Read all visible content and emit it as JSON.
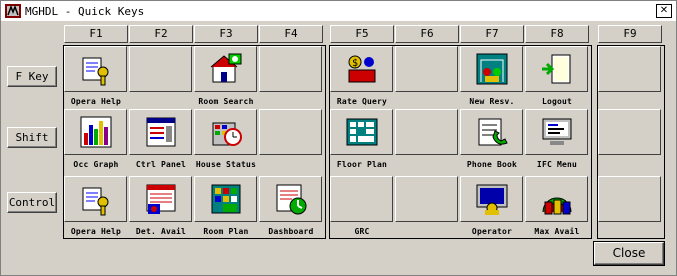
{
  "window": {
    "title": "MGHDL - Quick Keys",
    "close_glyph": "✕"
  },
  "side_buttons": {
    "fkey": "F Key",
    "shift": "Shift",
    "control": "Control"
  },
  "fkeys": [
    "F1",
    "F2",
    "F3",
    "F4",
    "F5",
    "F6",
    "F7",
    "F8",
    "F9"
  ],
  "rows": {
    "fkey": [
      "Opera Help",
      "",
      "Room Search",
      "",
      "Rate Query",
      "",
      "New Resv.",
      "Logout",
      ""
    ],
    "shift": [
      "Occ Graph",
      "Ctrl Panel",
      "House Status",
      "",
      "Floor Plan",
      "",
      "Phone Book",
      "IFC Menu",
      ""
    ],
    "control": [
      "Opera Help",
      "Det. Avail",
      "Room Plan",
      "Dashboard",
      "GRC",
      "",
      "Operator",
      "Max Avail",
      ""
    ]
  },
  "icons": {
    "fkey": [
      "help-book-key-icon",
      "",
      "room-search-icon",
      "",
      "rate-query-icon",
      "",
      "new-reservation-icon",
      "logout-door-icon",
      ""
    ],
    "shift": [
      "occupancy-graph-icon",
      "control-panel-icon",
      "house-status-icon",
      "",
      "floor-plan-icon",
      "",
      "phone-book-icon",
      "ifc-menu-icon",
      ""
    ],
    "control": [
      "help-book-key-icon",
      "detailed-availability-icon",
      "room-plan-icon",
      "dashboard-icon",
      "",
      "",
      "operator-icon",
      "max-availability-icon",
      ""
    ]
  },
  "close_button": {
    "label": "Close"
  }
}
